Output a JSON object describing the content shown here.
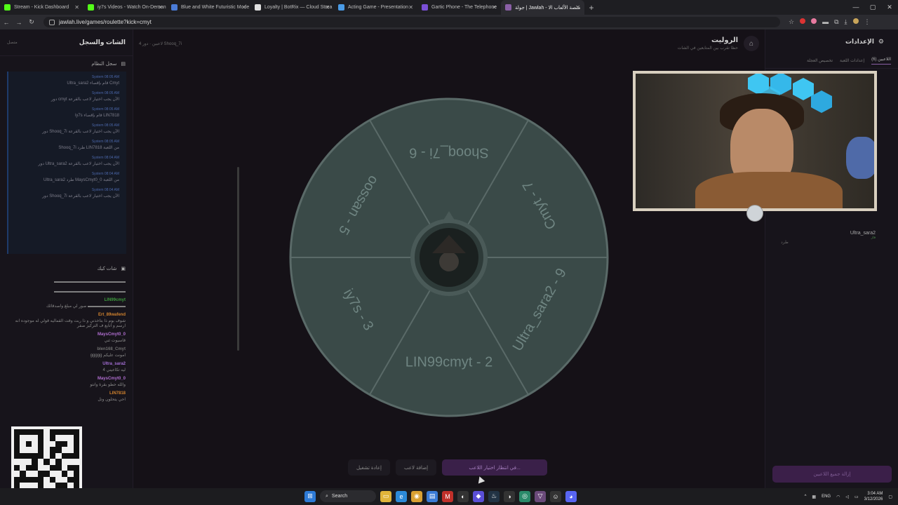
{
  "browser": {
    "tabs": [
      {
        "label": "Stream - Kick Dashboard",
        "color": "#53fc18"
      },
      {
        "label": "iy7s Videos - Watch On-Deman",
        "color": "#53fc18"
      },
      {
        "label": "Blue and White Futuristic Mode",
        "color": "#4a7bd6"
      },
      {
        "label": "Loyalty | BotRix — Cloud Strea",
        "color": "#e0e0e0"
      },
      {
        "label": "Acting Game - Presentation",
        "color": "#4a9be6"
      },
      {
        "label": "Gartic Phone - The Telephone",
        "color": "#7a4fd6"
      },
      {
        "label": "جولة | Jawlah - منصة الألعاب الا",
        "color": "#8a5fa6"
      }
    ],
    "url": "jawlah.live/games/roulette?kick=cmyt",
    "newtab_label": "+"
  },
  "left_panel": {
    "title": "الشات والسجل",
    "status": "متصل",
    "syslog_title": "سجل النظام",
    "log_items": [
      {
        "meta": "System 08:05 AM",
        "msg": "Ultra_sara2 قام بإقصاء Cmyt"
      },
      {
        "meta": "System 08:05 AM",
        "msg": "دور cmyt الآن يجب اختيار لاعب بالقرعة"
      },
      {
        "meta": "System 08:05 AM",
        "msg": "iy7s قام بإقصاء LIN7818"
      },
      {
        "meta": "System 08:05 AM",
        "msg": "دور Shooq_7i الآن يجب اختيار لاعب بالقرعة"
      },
      {
        "meta": "System 08:05 AM",
        "msg": "Shooq_7i طرد LIN7818 من اللعبة"
      },
      {
        "meta": "System 08:04 AM",
        "msg": "دور Ultra_sara2 الآن يجب اختيار لاعب بالقرعة"
      },
      {
        "meta": "System 08:04 AM",
        "msg": "Ultra_sara2 طرد MaysCmyt0_0 من اللعبة"
      },
      {
        "meta": "System 08:04 AM",
        "msg": "دور Shooq_7i الآن يجب اختيار لاعب بالقرعة"
      }
    ],
    "chat_title": "شات كيك",
    "chat_items": [
      {
        "user": "",
        "text": "▬▬▬▬▬▬▬▬▬▬▬▬▬▬▬▬▬",
        "color": "#8a8a8a"
      },
      {
        "user": "",
        "text": "▬▬▬▬▬▬▬▬▬▬▬▬▬▬▬▬▬",
        "color": "#8a8a8a"
      },
      {
        "user": "LIN99cmyt",
        "text": "صور لي مبلغ واصدقائك ▬▬▬▬▬▬▬▬▬",
        "color": "#3e9b3e"
      },
      {
        "user": "Ert_89wafend",
        "text": "شوف بوم ذا بتاخذني و ذا ربت وقت القماليه قولي له موجوده انه ارسم و اتابع ف التركيز صفر",
        "color": "#d0822e"
      },
      {
        "user": "MaysCmyt0_0",
        "text": "قاسيوت ثني",
        "color": "#b06ed0"
      },
      {
        "user": "blen168_Cmyt",
        "text": "ggggg امونت عليكم",
        "color": "#6f6f6f"
      },
      {
        "user": "Ultra_sara2",
        "text": "4 ليه تكاعيني",
        "color": "#a56fd6"
      },
      {
        "user": "MaysCmyt0_0",
        "text": "والله حطو بقرة وانتو",
        "color": "#b06ed0"
      },
      {
        "user": "LIN7818",
        "text": "احي يتحلون ونل",
        "color": "#d0822e"
      }
    ]
  },
  "center": {
    "breadcrumb": "4 لاعبين · دور Shooq_7i",
    "title": "الروليت",
    "subtitle": "حظا تقرب بين المتابعين في الشات",
    "wheel_labels": [
      "Shooq_7i - 6",
      "Cmyt - 7",
      "Ultra_sara2 - 9",
      "LIN99cmyt - 2",
      "iy7s - 3",
      "oossan - 5"
    ],
    "buttons": {
      "spin": "في انتظار اختيار اللاعب...",
      "add_player": "إضافة لاعب",
      "restart": "إعادة تشغيل"
    }
  },
  "right_panel": {
    "title": "الإعدادات",
    "tabs": [
      "اللاعبين (6)",
      "إعدادات اللعبة",
      "تخصيص العجلة"
    ],
    "player_name": "Ultra_sara2",
    "player_status": "فاز",
    "kick_label": "طرد",
    "remove_all": "إزالة جميع اللاعبين"
  },
  "taskbar": {
    "search_label": "Search",
    "lang": "ENG",
    "time": "3:04 AM",
    "date": "3/12/2026"
  },
  "colors": {
    "accent": "#8a5fa6",
    "wheel_fill": "#3a4a48",
    "wheel_line": "#5a6a68"
  }
}
